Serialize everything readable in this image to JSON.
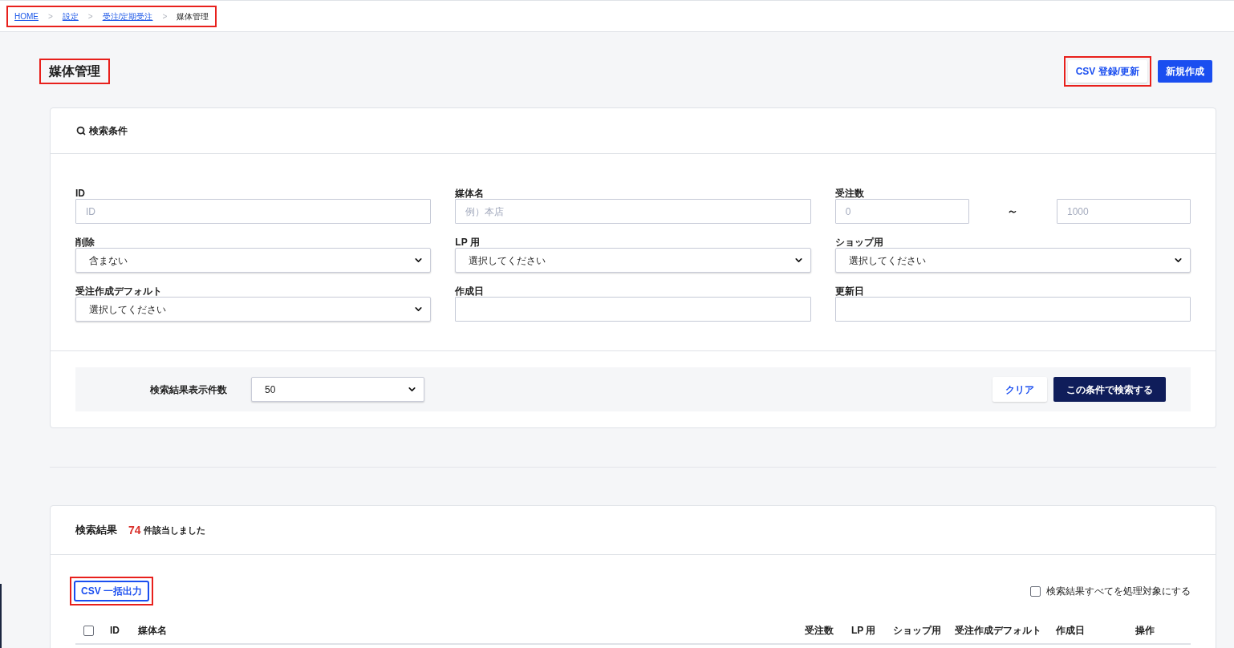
{
  "breadcrumb": {
    "highlighted": true,
    "items": [
      {
        "label": "HOME",
        "kind": "link"
      },
      {
        "separator": ">",
        "label": "設定",
        "kind": "link"
      },
      {
        "separator": ">",
        "label": "受注/定期受注",
        "kind": "link"
      },
      {
        "separator": ">",
        "label": "媒体管理",
        "kind": "current"
      }
    ]
  },
  "page_header": {
    "title": "媒体管理",
    "title_highlighted": true,
    "buttons": [
      {
        "label": "CSV 登録/更新",
        "kind": "secondary",
        "highlighted": true
      },
      {
        "label": "新規作成",
        "kind": "primary",
        "highlighted": false
      }
    ]
  },
  "search_panel": {
    "title": "検索条件",
    "fields": [
      {
        "label": "ID",
        "kind": "text",
        "placeholder": "ID"
      },
      {
        "label": "媒体名",
        "kind": "text",
        "placeholder": "例）本店"
      },
      {
        "label": "受注数",
        "kind": "range",
        "placeholder_from": "0",
        "separator": "～",
        "placeholder_to": "1000"
      },
      {
        "label": "削除",
        "kind": "select",
        "value": "含まない"
      },
      {
        "label": "LP 用",
        "kind": "select",
        "value": "選択してください"
      },
      {
        "label": "ショップ用",
        "kind": "select",
        "value": "選択してください"
      },
      {
        "label": "受注作成デフォルト",
        "kind": "select",
        "value": "選択してください"
      },
      {
        "label": "作成日",
        "kind": "text"
      },
      {
        "label": "更新日",
        "kind": "text"
      }
    ],
    "footer": {
      "per_page_label": "検索結果表示件数",
      "per_page_value": "50",
      "buttons": [
        {
          "label": "クリア",
          "kind": "secondary"
        },
        {
          "label": "この条件で検索する",
          "kind": "primary"
        }
      ]
    }
  },
  "results_panel": {
    "title": "検索結果",
    "count": "74",
    "count_suffix": "件該当しました",
    "export_button": {
      "label": "CSV 一括出力",
      "highlighted": true
    },
    "select_all": {
      "label": "検索結果すべてを処理対象にする",
      "checked": false
    },
    "table": {
      "header_checked": false,
      "columns": [
        "ID",
        "媒体名",
        "受注数",
        "LP 用",
        "ショップ用",
        "受注作成デフォルト",
        "作成日",
        "操作"
      ]
    }
  }
}
